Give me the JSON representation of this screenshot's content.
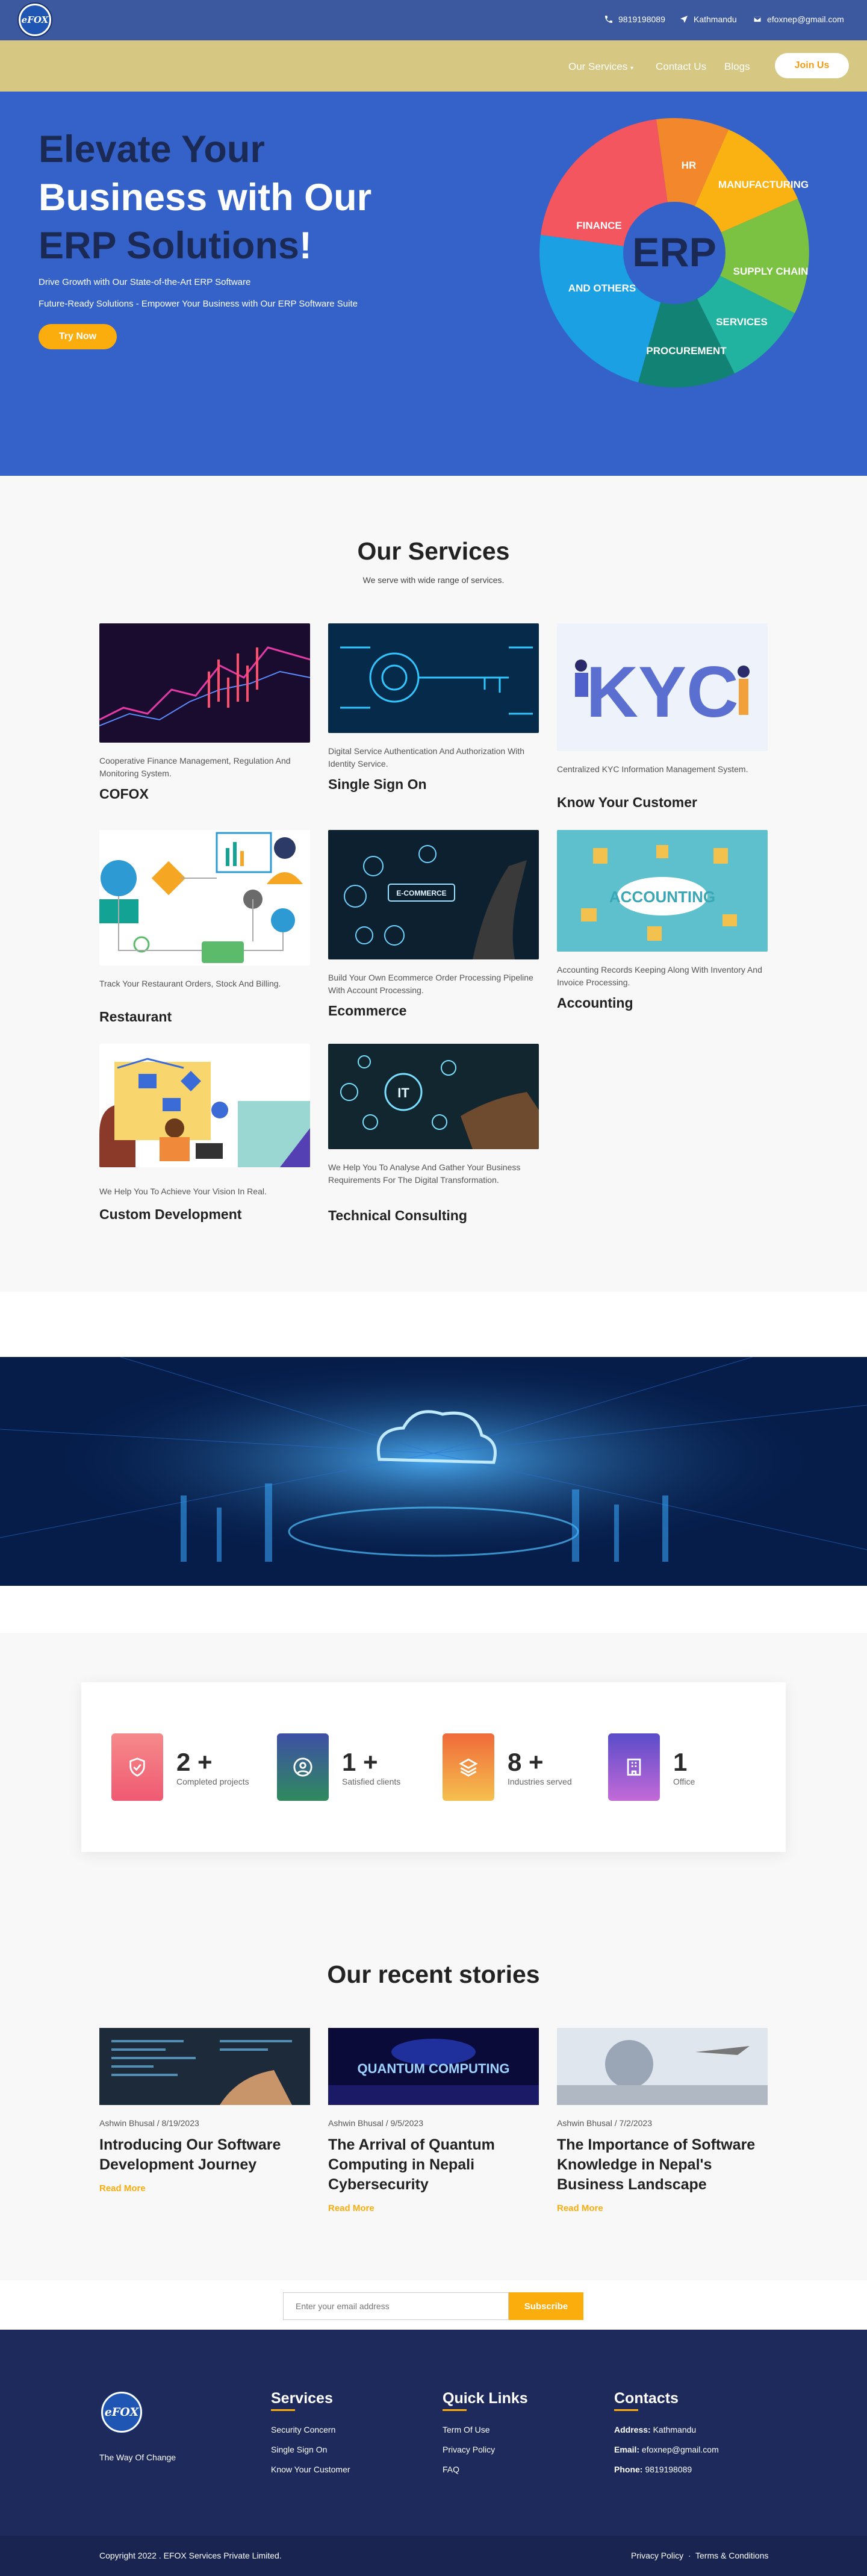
{
  "brand": {
    "logo_text": "eFOX",
    "tagline": "The Way Of Change"
  },
  "topbar": {
    "phone": "9819198089",
    "location": "Kathmandu",
    "email": "efoxnep@gmail.com"
  },
  "nav": {
    "services": "Our Services",
    "contact": "Contact Us",
    "blogs": "Blogs",
    "join": "Join Us"
  },
  "hero": {
    "line1": "Elevate Your",
    "line2": "Business with Our",
    "line3": "ERP Solutions",
    "line3_mark": "!",
    "sub1": "Drive Growth with Our State-of-the-Art ERP Software",
    "sub2": "Future-Ready Solutions - Empower Your Business with Our ERP Software Suite",
    "cta": "Try Now",
    "wheel": {
      "center": "ERP",
      "segments": [
        "HR",
        "MANUFACTURING",
        "SUPPLY CHAIN",
        "SERVICES",
        "PROCUREMENT",
        "AND OTHERS",
        "FINANCE"
      ]
    }
  },
  "services": {
    "title": "Our Services",
    "subtitle": "We serve with wide range of services.",
    "cards": [
      {
        "desc": "Cooperative Finance Management, Regulation And Monitoring System.",
        "title": "COFOX"
      },
      {
        "desc": "Digital Service Authentication And Authorization With Identity Service.",
        "title": "Single Sign On"
      },
      {
        "desc": "Centralized KYC Information Management System.",
        "title": "Know Your Customer",
        "img_text": "KYC"
      },
      {
        "desc": "Track Your Restaurant Orders, Stock And Billing.",
        "title": "Restaurant"
      },
      {
        "desc": "Build Your Own Ecommerce Order Processing Pipeline With Account Processing.",
        "title": "Ecommerce",
        "img_text": "E-COMMERCE"
      },
      {
        "desc": "Accounting Records Keeping Along With Inventory And Invoice Processing.",
        "title": "Accounting",
        "img_text": "ACCOUNTING"
      },
      {
        "desc": "We Help You To Achieve Your Vision In Real.",
        "title": "Custom Development"
      },
      {
        "desc": "We Help You To Analyse And Gather Your Business Requirements For The Digital Transformation.",
        "title": "Technical Consulting",
        "img_text": "IT"
      }
    ]
  },
  "stats": [
    {
      "num": "2 +",
      "label": "Completed projects",
      "icon": "shield-icon",
      "color": "#f06c7e"
    },
    {
      "num": "1 +",
      "label": "Satisfied clients",
      "icon": "user-icon",
      "color": "#2f8a5e"
    },
    {
      "num": "8 +",
      "label": "Industries served",
      "icon": "layers-icon",
      "color": "#f08a3a"
    },
    {
      "num": "1",
      "label": "Office",
      "icon": "building-icon",
      "color": "#a45ad8"
    }
  ],
  "stories": {
    "title": "Our recent stories",
    "items": [
      {
        "meta": "Ashwin Bhusal / 8/19/2023",
        "title": "Introducing Our Software Development Journey",
        "more": "Read More"
      },
      {
        "meta": "Ashwin Bhusal / 9/5/2023",
        "title": "The Arrival of Quantum Computing in Nepali Cybersecurity",
        "more": "Read More",
        "img_text": "QUANTUM COMPUTING"
      },
      {
        "meta": "Ashwin Bhusal / 7/2/2023",
        "title": "The Importance of Software Knowledge in Nepal's Business Landscape",
        "more": "Read More"
      }
    ]
  },
  "subscribe": {
    "placeholder": "Enter your email address",
    "button": "Subscribe"
  },
  "footer": {
    "services_head": "Services",
    "services": [
      "Security Concern",
      "Single Sign On",
      "Know Your Customer"
    ],
    "links_head": "Quick Links",
    "links": [
      "Term Of Use",
      "Privacy Policy",
      "FAQ"
    ],
    "contacts_head": "Contacts",
    "address_label": "Address:",
    "address": "Kathmandu",
    "email_label": "Email:",
    "email": "efoxnep@gmail.com",
    "phone_label": "Phone:",
    "phone": "9819198089",
    "copyright": "Copyright 2022 . EFOX Services Private Limited.",
    "privacy": "Privacy Policy",
    "sep": "·",
    "terms": "Terms & Conditions"
  },
  "colors": {
    "accent": "#fbad0e",
    "topbar": "#3c59a0",
    "nav": "#d6c783",
    "hero": "#3562c8",
    "footer": "#1d2a5b"
  }
}
